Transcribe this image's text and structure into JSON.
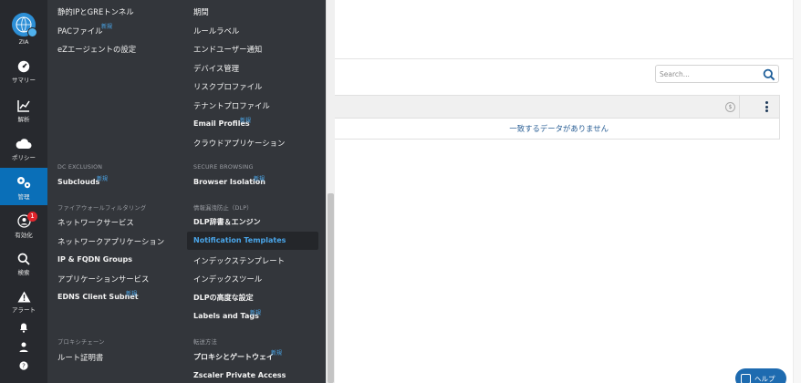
{
  "nav": {
    "items": [
      {
        "label": "ZIA",
        "icon": "zia-logo-icon"
      },
      {
        "label": "サマリー",
        "icon": "dashboard-gauge-icon"
      },
      {
        "label": "解析",
        "icon": "analytics-chart-icon"
      },
      {
        "label": "ポリシー",
        "icon": "cloud-icon"
      },
      {
        "label": "管理",
        "icon": "gears-icon",
        "active": true
      },
      {
        "label": "有効化",
        "icon": "activate-user-icon",
        "badge": "1"
      },
      {
        "label": "検索",
        "icon": "search-icon"
      },
      {
        "label": "アラート",
        "icon": "warning-icon"
      },
      {
        "label": "",
        "icon": "bell-icon"
      },
      {
        "label": "",
        "icon": "user-icon"
      },
      {
        "label": "",
        "icon": "help-circle-icon"
      }
    ]
  },
  "menu": {
    "left": {
      "items_top": [
        "静的IPとGREトンネル",
        "PACファイル",
        "eZエージェントの設定"
      ],
      "sec_dc": "DC EXCLUSION",
      "subclouds": "Subclouds",
      "sec_firewall": "ファイアウォールフィルタリング",
      "firewall_items": [
        "ネットワークサービス",
        "ネットワークアプリケーション",
        "IP & FQDN Groups",
        "アプリケーションサービス",
        "EDNS Client Subnet"
      ],
      "sec_proxy_chain": "プロキシチェーン",
      "root_cert": "ルート証明書"
    },
    "right": {
      "items_top": [
        "期間",
        "ルールラベル",
        "エンドユーザー通知",
        "デバイス管理",
        "リスクプロファイル",
        "テナントプロファイル",
        "Email Profiles",
        "クラウドアプリケーション"
      ],
      "sec_secure": "SECURE BROWSING",
      "browser_isolation": "Browser Isolation",
      "sec_dlp": "情報漏洩防止（DLP）",
      "dlp_items": [
        "DLP辞書＆エンジン",
        "Notification Templates",
        "インデックステンプレート",
        "インデックスツール",
        "DLPの高度な設定",
        "Labels and Tags"
      ],
      "sec_forwarding": "転送方法",
      "forwarding_items": [
        "プロキシとゲートウェイ",
        "Zscaler Private Access"
      ]
    },
    "new_label": "新規"
  },
  "main": {
    "search_placeholder": "Search...",
    "no_data": "一致するデータがありません",
    "info_glyph": "$",
    "help_label": "ヘルプ"
  },
  "colors": {
    "nav_bg": "#27292e",
    "menu_bg": "#33363b",
    "accent": "#4aa6ea",
    "active_nav": "#0a6fb8"
  }
}
